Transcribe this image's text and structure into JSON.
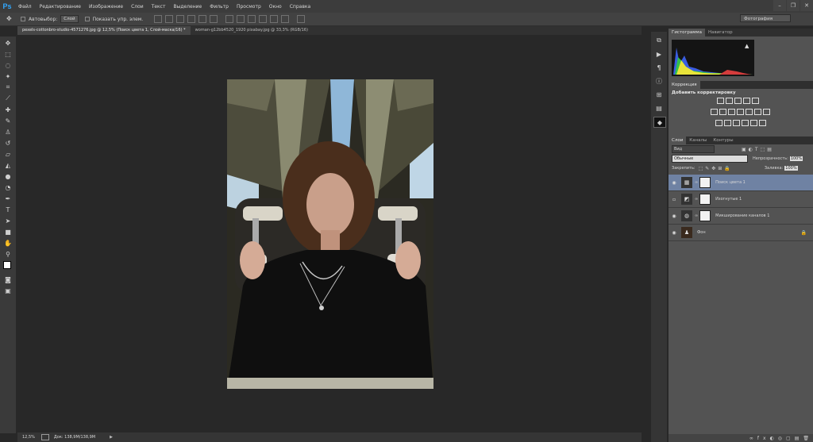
{
  "app": {
    "logo": "Ps"
  },
  "menu": [
    "Файл",
    "Редактирование",
    "Изображение",
    "Слои",
    "Текст",
    "Выделение",
    "Фильтр",
    "Просмотр",
    "Окно",
    "Справка"
  ],
  "window_controls": [
    "–",
    "❐",
    "✕"
  ],
  "options": {
    "autoselect_label": "Автовыбор:",
    "autoselect_value": "Слой",
    "show_controls_label": "Показать упр. элем."
  },
  "workspace": "Фотография",
  "tabs": [
    "pexels-cottonbro-studio-4571276.jpg @ 12,5% (Поиск цвета 1, Слой-маска/16) *",
    "woman-g12bb4520_1920 pixabay.jpg @ 33,3% (RGB/16)"
  ],
  "status": {
    "zoom": "12,5%",
    "doc": "Док: 138,9M/138,9M"
  },
  "panels": {
    "histogram_tab": "Гистограмма",
    "navigator_tab": "Навигатор",
    "corrections_title": "Коррекция",
    "add_correction": "Добавить корректировку",
    "layers_tab": "Слои",
    "channels_tab": "Каналы",
    "paths_tab": "Контуры",
    "kind_filter": "Вид",
    "blend_mode": "Обычные",
    "opacity_label": "Непрозрачность:",
    "opacity_value": "100%",
    "lock_label": "Закрепить:",
    "fill_label": "Заливка:",
    "fill_value": "100%"
  },
  "layers": [
    {
      "name": "Поиск цвета 1",
      "selected": true
    },
    {
      "name": "Изогнутые 1",
      "selected": false
    },
    {
      "name": "Микширование каналов 1",
      "selected": false
    },
    {
      "name": "Фон",
      "selected": false
    }
  ],
  "colors": {
    "accent": "#6f82a3",
    "ps_blue": "#31a8ff"
  }
}
